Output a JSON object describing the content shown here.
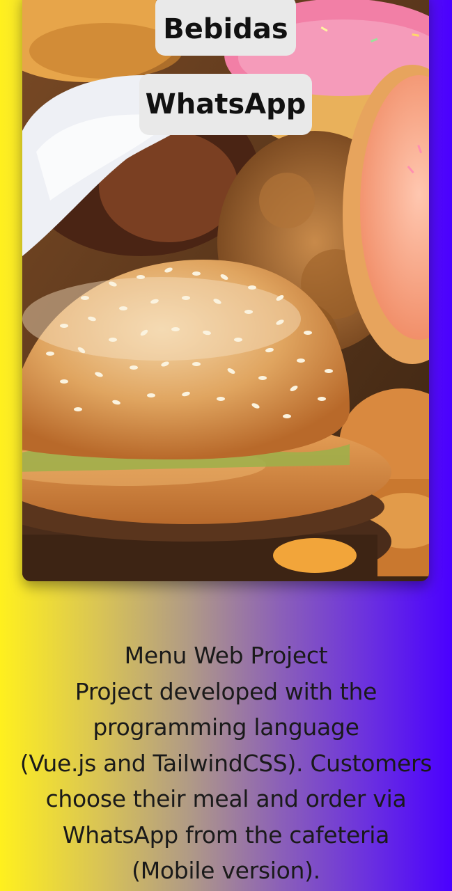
{
  "hero": {
    "image_alt": "fast-food-photo",
    "buttons": {
      "bebidas_label": "Bebidas",
      "whatsapp_label": "WhatsApp"
    }
  },
  "description": {
    "title": "Menu Web Project",
    "lines": [
      "Project developed with the",
      "programming language",
      "(Vue.js and TailwindCSS). Customers",
      "choose their meal and order via",
      "WhatsApp from the cafeteria",
      "(Mobile version)."
    ]
  },
  "colors": {
    "gradient_start": "#fff01e",
    "gradient_end": "#4a00ff",
    "button_bg": "#e9e9e9",
    "text": "#1a1a1a"
  }
}
